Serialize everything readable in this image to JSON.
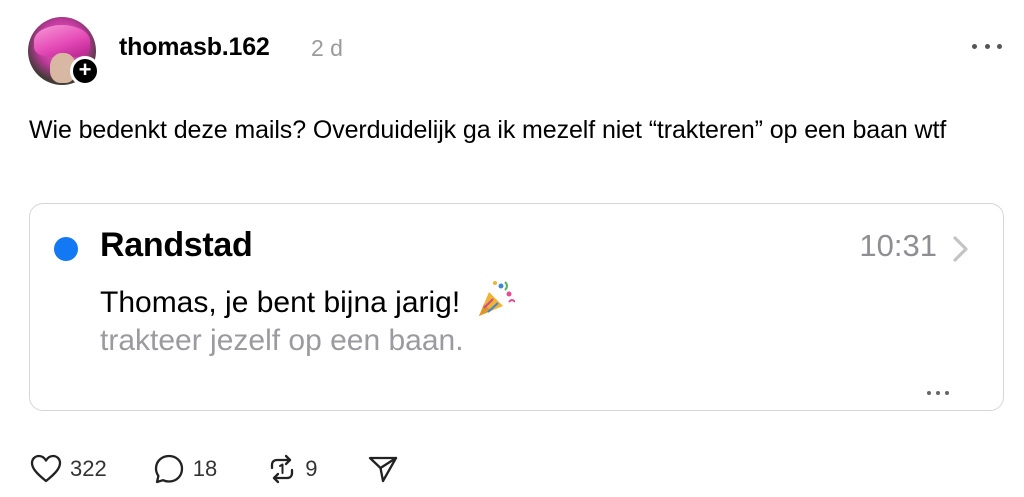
{
  "post": {
    "username": "thomasb.162",
    "timestamp": "2 d",
    "text": "Wie bedenkt deze mails? Overduidelijk ga ik mezelf niet “trakteren” op een baan wtf",
    "follow_icon": "plus-icon",
    "more_icon": "ellipsis-icon"
  },
  "email_card": {
    "sender": "Randstad",
    "time": "10:31",
    "subject": "Thomas, je bent bijna jarig!",
    "subject_icon": "party-popper-icon",
    "preview": "trakteer jezelf op een baan.",
    "unread_color": "#1278f3"
  },
  "actions": {
    "likes": "322",
    "replies": "18",
    "reposts": "9",
    "like_icon": "heart-icon",
    "reply_icon": "speech-bubble-icon",
    "repost_icon": "repost-icon",
    "share_icon": "send-icon"
  }
}
